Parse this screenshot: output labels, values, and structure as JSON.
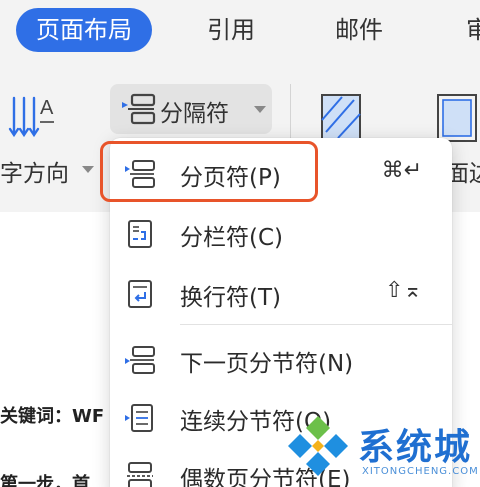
{
  "ribbon_tabs": [
    {
      "label": "页面布局",
      "active": true
    },
    {
      "label": "引用",
      "active": false
    },
    {
      "label": "邮件",
      "active": false
    },
    {
      "label": "审",
      "active": false
    }
  ],
  "ribbon": {
    "text_direction_label": "字方向",
    "text_direction_icon": "text-direction-icon",
    "breaks_label": "分隔符",
    "border_label": "面边",
    "accent_color": "#2f6fe6"
  },
  "document": {
    "line1": "关键词：WF",
    "line2": "第一步，首"
  },
  "breaks_menu": {
    "items": [
      {
        "label": "分页符(P)",
        "shortcut": "⌘↵",
        "icon": "page-break-icon",
        "highlighted": true
      },
      {
        "label": "分栏符(C)",
        "shortcut": "",
        "icon": "column-break-icon",
        "highlighted": false
      },
      {
        "label": "换行符(T)",
        "shortcut": "⇧⌅",
        "icon": "line-break-icon",
        "highlighted": false
      },
      {
        "label": "下一页分节符(N)",
        "shortcut": "",
        "icon": "next-page-section-break-icon",
        "highlighted": false
      },
      {
        "label": "连续分节符(O)",
        "shortcut": "",
        "icon": "continuous-section-break-icon",
        "highlighted": false
      },
      {
        "label": "偶数页分节符(E)",
        "shortcut": "",
        "icon": "even-page-section-break-icon",
        "highlighted": false
      }
    ],
    "highlight_color": "#e8542a"
  },
  "watermark": {
    "title": "系统城",
    "subtitle": "XITONGCHENG.COM"
  }
}
